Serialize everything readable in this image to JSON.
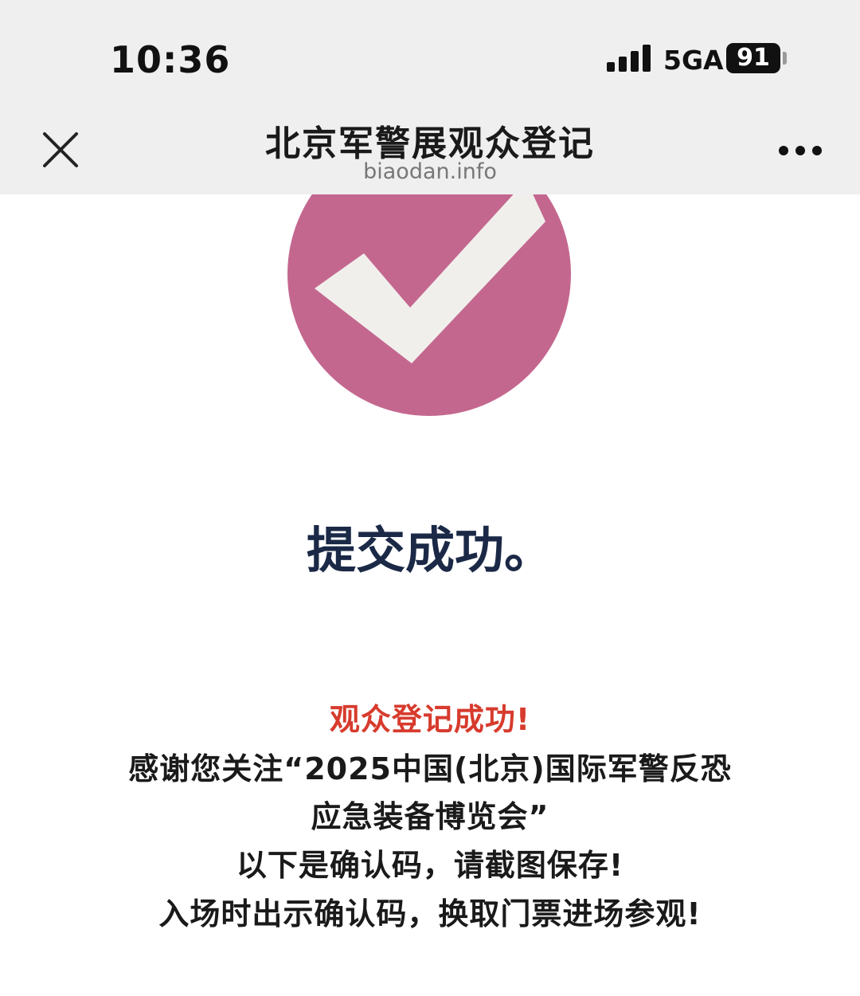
{
  "status_bar": {
    "time": "10:36",
    "network": "5GA",
    "battery": "91"
  },
  "nav": {
    "title": "北京军警展观众登记",
    "domain": "biaodan.info",
    "close_icon": "close-icon",
    "more_icon": "more-dots-icon"
  },
  "content": {
    "icon": "checkmark-circle-icon",
    "icon_color": "#c4678f",
    "heading": "提交成功。",
    "message_highlight": "观众登记成功!",
    "message_highlight_color": "#d73b2d",
    "message_lines": [
      "感谢您关注“2025中国(北京)国际军警反恐",
      "应急装备博览会”",
      "以下是确认码，请截图保存!",
      "入场时出示确认码，换取门票进场参观!"
    ]
  }
}
